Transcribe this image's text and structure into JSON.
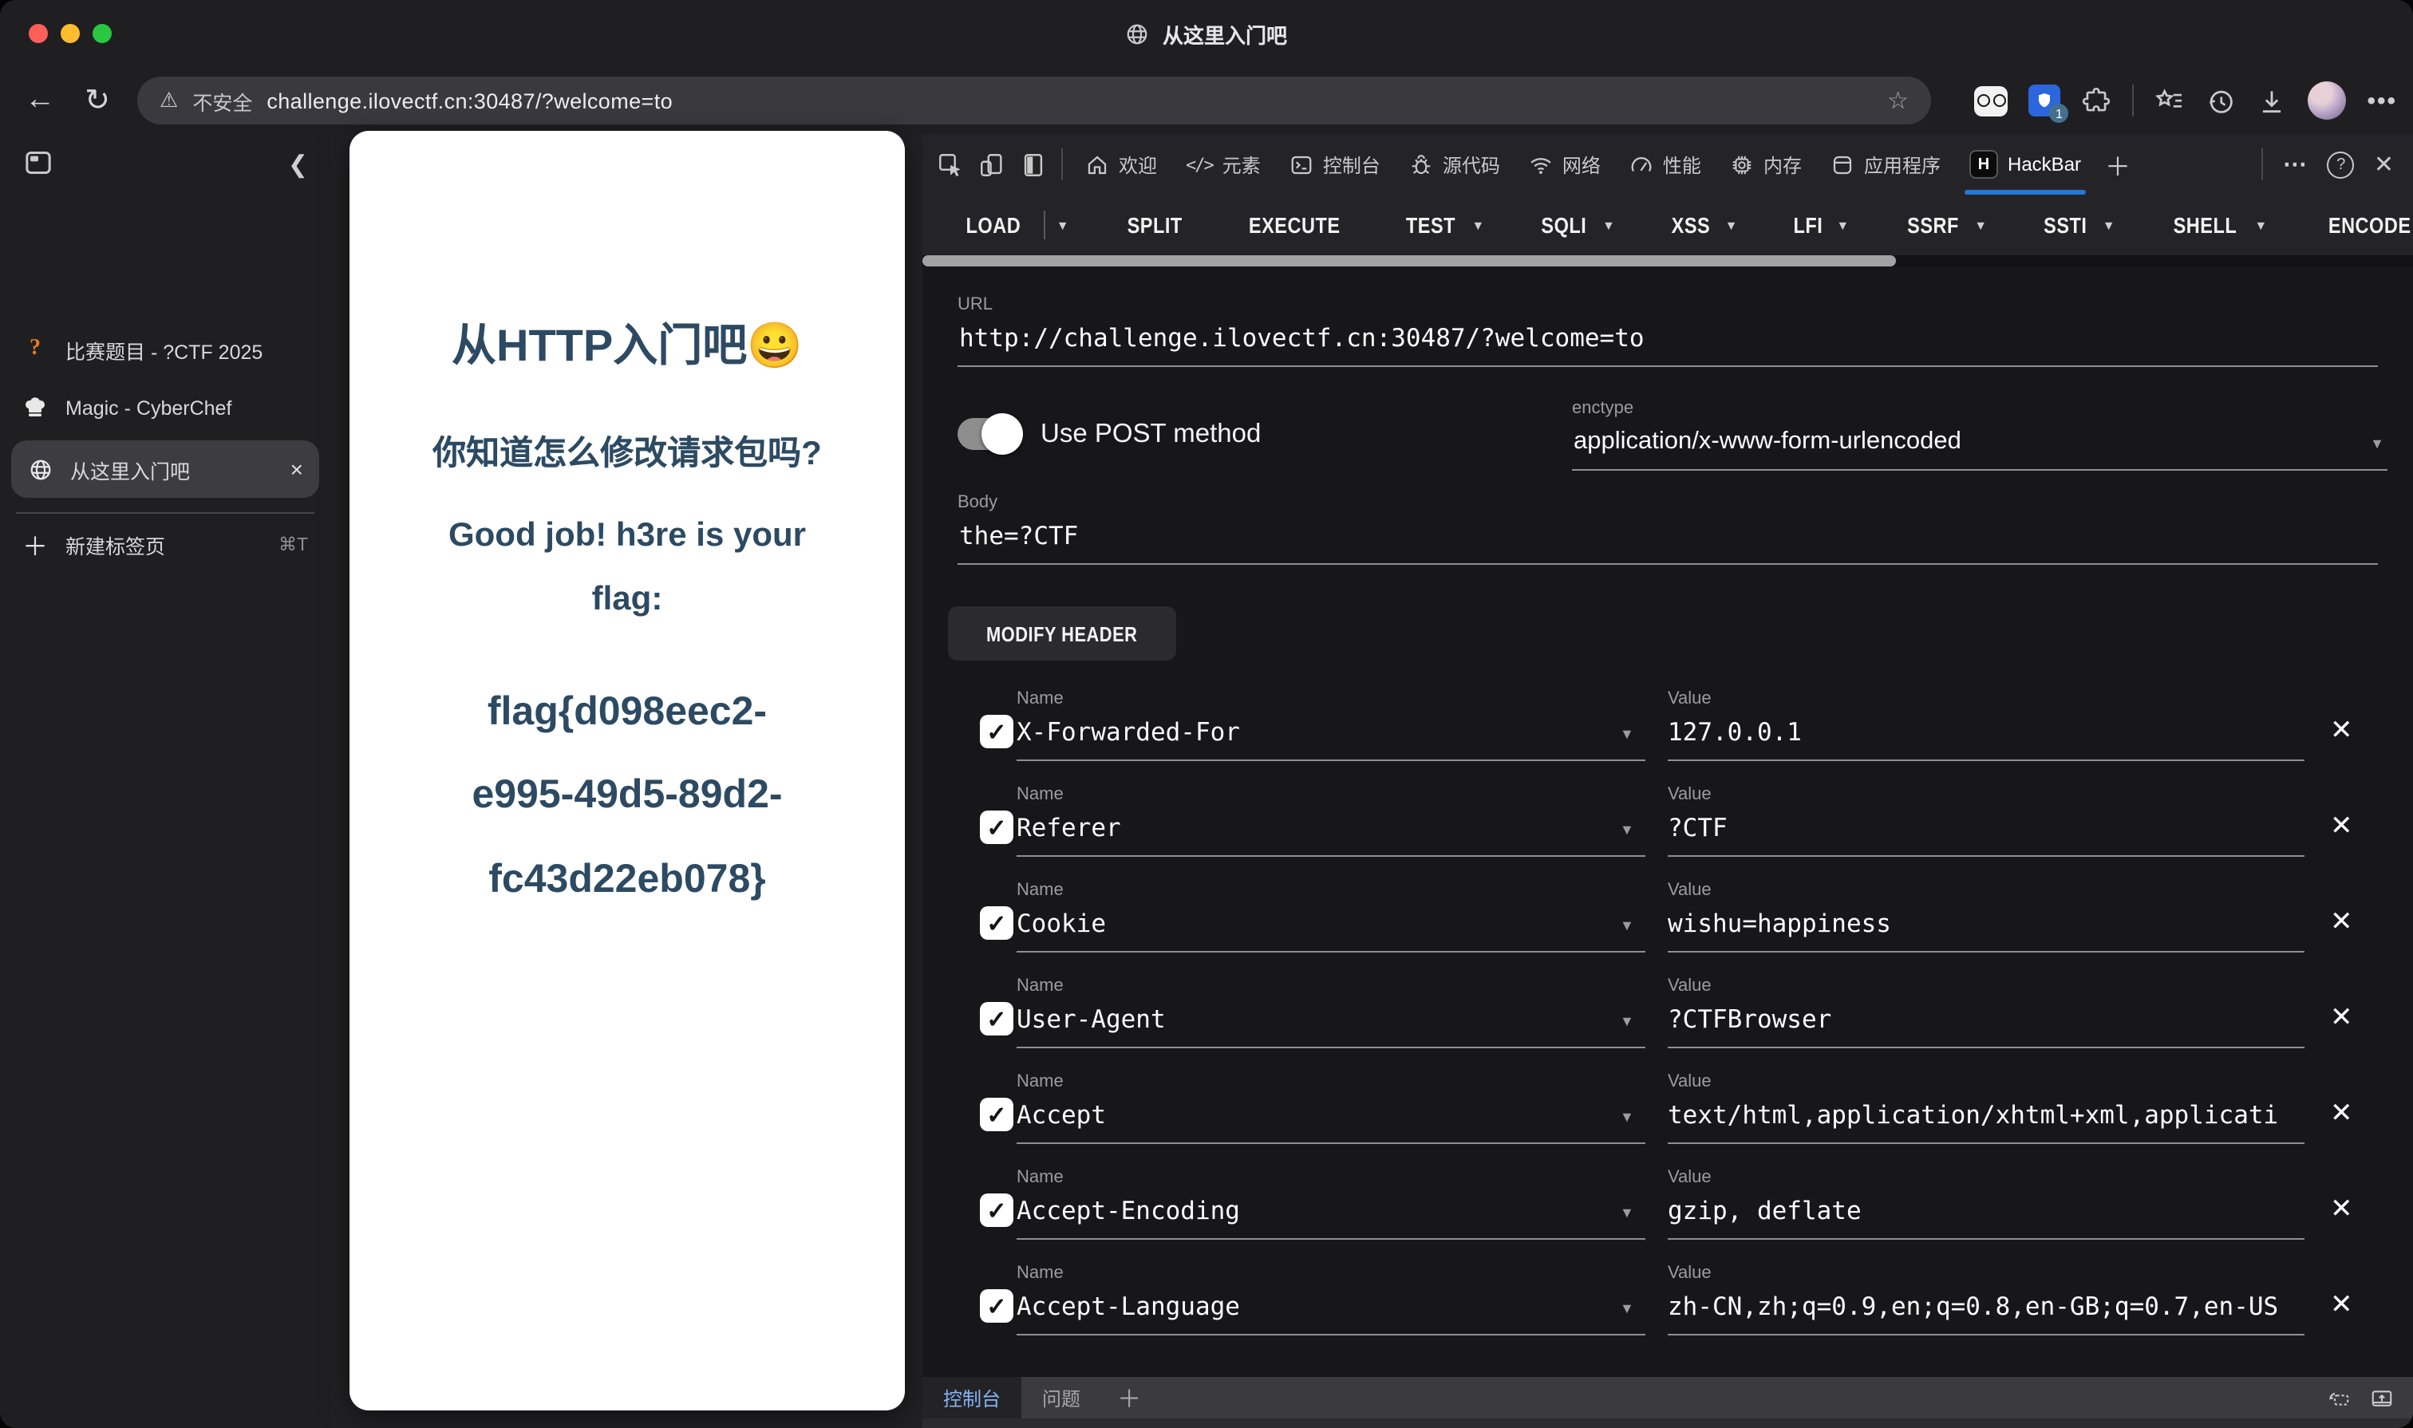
{
  "window": {
    "title": "从这里入门吧"
  },
  "toolbar": {
    "security_label": "不安全",
    "url": "challenge.ilovectf.cn:30487/?welcome=to",
    "extension_badge": "1"
  },
  "sidebar": {
    "tabs": [
      {
        "label": "比赛题目 - ?CTF 2025"
      },
      {
        "label": "Magic - CyberChef"
      },
      {
        "label": "从这里入门吧",
        "active": true
      }
    ],
    "new_tab_label": "新建标签页",
    "new_tab_shortcut": "⌘T"
  },
  "page": {
    "title": "从HTTP入门吧😀",
    "question": "你知道怎么修改请求包吗?",
    "message_line1": "Good job! h3re is your",
    "message_line2": "flag:",
    "flag_line1": "flag{d098eec2-",
    "flag_line2": "e995-49d5-89d2-",
    "flag_line3": "fc43d22eb078}"
  },
  "devtools": {
    "tabs": [
      "欢迎",
      "元素",
      "控制台",
      "源代码",
      "网络",
      "性能",
      "内存",
      "应用程序",
      "HackBar"
    ],
    "active_tab": "HackBar"
  },
  "hackbar": {
    "menu": [
      {
        "label": "LOAD",
        "caret": true,
        "split": true
      },
      {
        "label": "SPLIT",
        "caret": false
      },
      {
        "label": "EXECUTE",
        "caret": false
      },
      {
        "label": "TEST",
        "caret": true
      },
      {
        "label": "SQLI",
        "caret": true
      },
      {
        "label": "XSS",
        "caret": true
      },
      {
        "label": "LFI",
        "caret": true
      },
      {
        "label": "SSRF",
        "caret": true
      },
      {
        "label": "SSTI",
        "caret": true
      },
      {
        "label": "SHELL",
        "caret": true
      },
      {
        "label": "ENCODE",
        "caret": false
      }
    ],
    "url_label": "URL",
    "url_value": "http://challenge.ilovectf.cn:30487/?welcome=to",
    "post_toggle_label": "Use POST method",
    "post_enabled": true,
    "enctype_label": "enctype",
    "enctype_value": "application/x-www-form-urlencoded",
    "body_label": "Body",
    "body_value": "the=?CTF",
    "modify_header_label": "MODIFY HEADER",
    "field_name_label": "Name",
    "field_value_label": "Value",
    "headers": [
      {
        "name": "X-Forwarded-For",
        "value": "127.0.0.1",
        "checked": true
      },
      {
        "name": "Referer",
        "value": "?CTF",
        "checked": true
      },
      {
        "name": "Cookie",
        "value": "wishu=happiness",
        "checked": true
      },
      {
        "name": "User-Agent",
        "value": "?CTFBrowser",
        "checked": true
      },
      {
        "name": "Accept",
        "value": "text/html,application/xhtml+xml,applicati",
        "checked": true
      },
      {
        "name": "Accept-Encoding",
        "value": "gzip, deflate",
        "checked": true
      },
      {
        "name": "Accept-Language",
        "value": "zh-CN,zh;q=0.9,en;q=0.8,en-GB;q=0.7,en-US",
        "checked": true
      }
    ]
  },
  "drawer": {
    "console_tab": "控制台",
    "issues_tab": "问题"
  },
  "colors": {
    "accent_blue": "#2478d4",
    "console_tab_text": "#86b3f4",
    "page_text": "#2d4a63",
    "bitwarden_blue": "#2b66dd"
  }
}
